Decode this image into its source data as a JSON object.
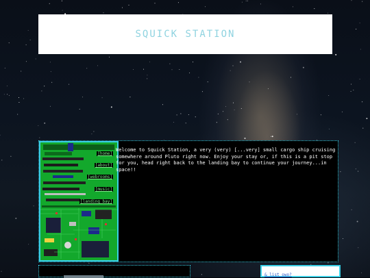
{
  "site": {
    "title": "SQUICK STATION"
  },
  "nav": {
    "items": [
      {
        "label": "[home]"
      },
      {
        "label": "[about]"
      },
      {
        "label": "[webrooms]"
      },
      {
        "label": "[music]"
      },
      {
        "label": "[landing bay]"
      }
    ]
  },
  "main": {
    "intro": "Welcome to Squick Station, a very (very) [...very] small cargo ship cruising somewhere around Pluto right now. Enjoy your stay or, if this is a pit stop for you, head right back to the landing bay to continue your journey...in space!!"
  },
  "sidebar_box": {
    "link": "& list owo?"
  },
  "colors": {
    "accent": "#3ad0e6",
    "banner_text": "#8fd3e0",
    "link_green": "#7cf28a",
    "circuit_green": "#12a52a"
  }
}
